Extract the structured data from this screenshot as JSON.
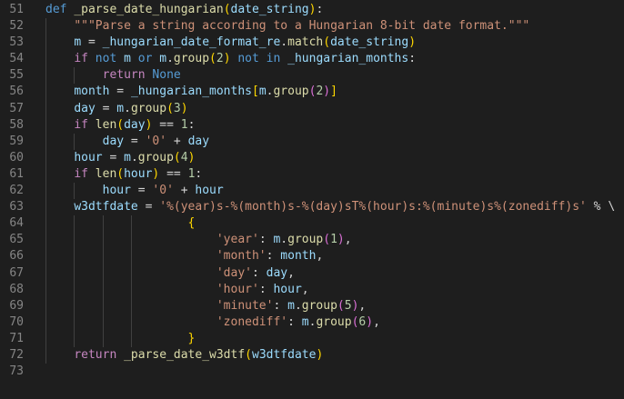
{
  "editor": {
    "language": "python",
    "colors": {
      "background": "#1e1e1e",
      "line_number": "#858585",
      "keyword": "#569cd6",
      "control": "#c586c0",
      "function": "#dcdcaa",
      "variable": "#9cdcfe",
      "string": "#ce9178",
      "number": "#b5cea8",
      "plain": "#d4d4d4"
    },
    "lines": [
      {
        "n": "51",
        "indent": 0,
        "tokens": [
          {
            "t": "def",
            "k": "keyword"
          },
          {
            "t": " ",
            "k": "plain"
          },
          {
            "t": "_parse_date_hungarian",
            "k": "func"
          },
          {
            "t": "(",
            "k": "bracket1"
          },
          {
            "t": "date_string",
            "k": "var"
          },
          {
            "t": ")",
            "k": "bracket1"
          },
          {
            "t": ":",
            "k": "plain"
          }
        ]
      },
      {
        "n": "52",
        "indent": 1,
        "tokens": [
          {
            "t": "\"\"\"Parse a string according to a Hungarian 8-bit date format.\"\"\"",
            "k": "string"
          }
        ]
      },
      {
        "n": "53",
        "indent": 1,
        "tokens": [
          {
            "t": "m",
            "k": "var"
          },
          {
            "t": " = ",
            "k": "plain"
          },
          {
            "t": "_hungarian_date_format_re",
            "k": "var"
          },
          {
            "t": ".",
            "k": "plain"
          },
          {
            "t": "match",
            "k": "func"
          },
          {
            "t": "(",
            "k": "bracket1"
          },
          {
            "t": "date_string",
            "k": "var"
          },
          {
            "t": ")",
            "k": "bracket1"
          }
        ]
      },
      {
        "n": "54",
        "indent": 1,
        "tokens": [
          {
            "t": "if",
            "k": "control"
          },
          {
            "t": " ",
            "k": "plain"
          },
          {
            "t": "not",
            "k": "keyword"
          },
          {
            "t": " ",
            "k": "plain"
          },
          {
            "t": "m",
            "k": "var"
          },
          {
            "t": " ",
            "k": "plain"
          },
          {
            "t": "or",
            "k": "keyword"
          },
          {
            "t": " ",
            "k": "plain"
          },
          {
            "t": "m",
            "k": "var"
          },
          {
            "t": ".",
            "k": "plain"
          },
          {
            "t": "group",
            "k": "func"
          },
          {
            "t": "(",
            "k": "bracket1"
          },
          {
            "t": "2",
            "k": "number"
          },
          {
            "t": ")",
            "k": "bracket1"
          },
          {
            "t": " ",
            "k": "plain"
          },
          {
            "t": "not",
            "k": "keyword"
          },
          {
            "t": " ",
            "k": "plain"
          },
          {
            "t": "in",
            "k": "keyword"
          },
          {
            "t": " ",
            "k": "plain"
          },
          {
            "t": "_hungarian_months",
            "k": "var"
          },
          {
            "t": ":",
            "k": "plain"
          }
        ]
      },
      {
        "n": "55",
        "indent": 2,
        "tokens": [
          {
            "t": "return",
            "k": "control"
          },
          {
            "t": " ",
            "k": "plain"
          },
          {
            "t": "None",
            "k": "keyword"
          }
        ]
      },
      {
        "n": "56",
        "indent": 1,
        "tokens": [
          {
            "t": "month",
            "k": "var"
          },
          {
            "t": " = ",
            "k": "plain"
          },
          {
            "t": "_hungarian_months",
            "k": "var"
          },
          {
            "t": "[",
            "k": "bracket1"
          },
          {
            "t": "m",
            "k": "var"
          },
          {
            "t": ".",
            "k": "plain"
          },
          {
            "t": "group",
            "k": "func"
          },
          {
            "t": "(",
            "k": "bracket2"
          },
          {
            "t": "2",
            "k": "number"
          },
          {
            "t": ")",
            "k": "bracket2"
          },
          {
            "t": "]",
            "k": "bracket1"
          }
        ]
      },
      {
        "n": "57",
        "indent": 1,
        "tokens": [
          {
            "t": "day",
            "k": "var"
          },
          {
            "t": " = ",
            "k": "plain"
          },
          {
            "t": "m",
            "k": "var"
          },
          {
            "t": ".",
            "k": "plain"
          },
          {
            "t": "group",
            "k": "func"
          },
          {
            "t": "(",
            "k": "bracket1"
          },
          {
            "t": "3",
            "k": "number"
          },
          {
            "t": ")",
            "k": "bracket1"
          }
        ]
      },
      {
        "n": "58",
        "indent": 1,
        "tokens": [
          {
            "t": "if",
            "k": "control"
          },
          {
            "t": " ",
            "k": "plain"
          },
          {
            "t": "len",
            "k": "func"
          },
          {
            "t": "(",
            "k": "bracket1"
          },
          {
            "t": "day",
            "k": "var"
          },
          {
            "t": ")",
            "k": "bracket1"
          },
          {
            "t": " == ",
            "k": "plain"
          },
          {
            "t": "1",
            "k": "number"
          },
          {
            "t": ":",
            "k": "plain"
          }
        ]
      },
      {
        "n": "59",
        "indent": 2,
        "tokens": [
          {
            "t": "day",
            "k": "var"
          },
          {
            "t": " = ",
            "k": "plain"
          },
          {
            "t": "'0'",
            "k": "string"
          },
          {
            "t": " + ",
            "k": "plain"
          },
          {
            "t": "day",
            "k": "var"
          }
        ]
      },
      {
        "n": "60",
        "indent": 1,
        "tokens": [
          {
            "t": "hour",
            "k": "var"
          },
          {
            "t": " = ",
            "k": "plain"
          },
          {
            "t": "m",
            "k": "var"
          },
          {
            "t": ".",
            "k": "plain"
          },
          {
            "t": "group",
            "k": "func"
          },
          {
            "t": "(",
            "k": "bracket1"
          },
          {
            "t": "4",
            "k": "number"
          },
          {
            "t": ")",
            "k": "bracket1"
          }
        ]
      },
      {
        "n": "61",
        "indent": 1,
        "tokens": [
          {
            "t": "if",
            "k": "control"
          },
          {
            "t": " ",
            "k": "plain"
          },
          {
            "t": "len",
            "k": "func"
          },
          {
            "t": "(",
            "k": "bracket1"
          },
          {
            "t": "hour",
            "k": "var"
          },
          {
            "t": ")",
            "k": "bracket1"
          },
          {
            "t": " == ",
            "k": "plain"
          },
          {
            "t": "1",
            "k": "number"
          },
          {
            "t": ":",
            "k": "plain"
          }
        ]
      },
      {
        "n": "62",
        "indent": 2,
        "tokens": [
          {
            "t": "hour",
            "k": "var"
          },
          {
            "t": " = ",
            "k": "plain"
          },
          {
            "t": "'0'",
            "k": "string"
          },
          {
            "t": " + ",
            "k": "plain"
          },
          {
            "t": "hour",
            "k": "var"
          }
        ]
      },
      {
        "n": "63",
        "indent": 1,
        "tokens": [
          {
            "t": "w3dtfdate",
            "k": "var"
          },
          {
            "t": " = ",
            "k": "plain"
          },
          {
            "t": "'%(year)s-%(month)s-%(day)sT%(hour)s:%(minute)s%(zonediff)s'",
            "k": "string"
          },
          {
            "t": " % \\",
            "k": "plain"
          }
        ]
      },
      {
        "n": "64",
        "indent": 4,
        "pad": "    ",
        "tokens": [
          {
            "t": "{",
            "k": "bracket1"
          }
        ]
      },
      {
        "n": "65",
        "indent": 4,
        "pad": "        ",
        "tokens": [
          {
            "t": "'year'",
            "k": "string"
          },
          {
            "t": ": ",
            "k": "plain"
          },
          {
            "t": "m",
            "k": "var"
          },
          {
            "t": ".",
            "k": "plain"
          },
          {
            "t": "group",
            "k": "func"
          },
          {
            "t": "(",
            "k": "bracket2"
          },
          {
            "t": "1",
            "k": "number"
          },
          {
            "t": ")",
            "k": "bracket2"
          },
          {
            "t": ",",
            "k": "plain"
          }
        ]
      },
      {
        "n": "66",
        "indent": 4,
        "pad": "        ",
        "tokens": [
          {
            "t": "'month'",
            "k": "string"
          },
          {
            "t": ": ",
            "k": "plain"
          },
          {
            "t": "month",
            "k": "var"
          },
          {
            "t": ",",
            "k": "plain"
          }
        ]
      },
      {
        "n": "67",
        "indent": 4,
        "pad": "        ",
        "tokens": [
          {
            "t": "'day'",
            "k": "string"
          },
          {
            "t": ": ",
            "k": "plain"
          },
          {
            "t": "day",
            "k": "var"
          },
          {
            "t": ",",
            "k": "plain"
          }
        ]
      },
      {
        "n": "68",
        "indent": 4,
        "pad": "        ",
        "tokens": [
          {
            "t": "'hour'",
            "k": "string"
          },
          {
            "t": ": ",
            "k": "plain"
          },
          {
            "t": "hour",
            "k": "var"
          },
          {
            "t": ",",
            "k": "plain"
          }
        ]
      },
      {
        "n": "69",
        "indent": 4,
        "pad": "        ",
        "tokens": [
          {
            "t": "'minute'",
            "k": "string"
          },
          {
            "t": ": ",
            "k": "plain"
          },
          {
            "t": "m",
            "k": "var"
          },
          {
            "t": ".",
            "k": "plain"
          },
          {
            "t": "group",
            "k": "func"
          },
          {
            "t": "(",
            "k": "bracket2"
          },
          {
            "t": "5",
            "k": "number"
          },
          {
            "t": ")",
            "k": "bracket2"
          },
          {
            "t": ",",
            "k": "plain"
          }
        ]
      },
      {
        "n": "70",
        "indent": 4,
        "pad": "        ",
        "tokens": [
          {
            "t": "'zonediff'",
            "k": "string"
          },
          {
            "t": ": ",
            "k": "plain"
          },
          {
            "t": "m",
            "k": "var"
          },
          {
            "t": ".",
            "k": "plain"
          },
          {
            "t": "group",
            "k": "func"
          },
          {
            "t": "(",
            "k": "bracket2"
          },
          {
            "t": "6",
            "k": "number"
          },
          {
            "t": ")",
            "k": "bracket2"
          },
          {
            "t": ",",
            "k": "plain"
          }
        ]
      },
      {
        "n": "71",
        "indent": 4,
        "pad": "    ",
        "tokens": [
          {
            "t": "}",
            "k": "bracket1"
          }
        ]
      },
      {
        "n": "72",
        "indent": 1,
        "tokens": [
          {
            "t": "return",
            "k": "control"
          },
          {
            "t": " ",
            "k": "plain"
          },
          {
            "t": "_parse_date_w3dtf",
            "k": "func"
          },
          {
            "t": "(",
            "k": "bracket1"
          },
          {
            "t": "w3dtfdate",
            "k": "var"
          },
          {
            "t": ")",
            "k": "bracket1"
          }
        ]
      },
      {
        "n": "73",
        "indent": 0,
        "tokens": []
      }
    ]
  }
}
